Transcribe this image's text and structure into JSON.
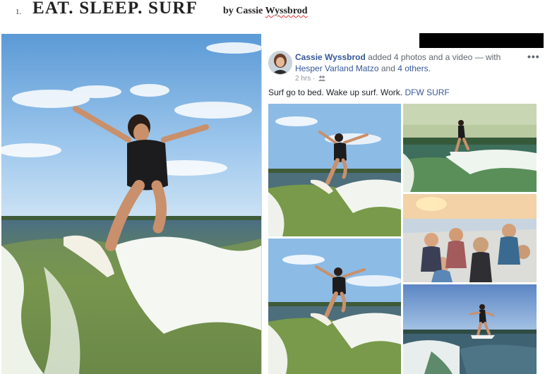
{
  "heading": {
    "number": "1.",
    "title": "EAT.  SLEEP.  SURF",
    "byline_prefix": "by Cassie",
    "byline_name": "Wyssbrod"
  },
  "post": {
    "author": "Cassie Wyssbrod",
    "action": "added 4 photos and a video",
    "with_text": "— with",
    "tagged_person": "Hesper Varland Matzo",
    "and_text": "and",
    "others": "4 others.",
    "time": "2 hrs",
    "audience_icon": "friends-icon",
    "more_icon": "more-options-icon",
    "body": "Surf go to bed. Wake up surf. Work.",
    "tag": "DFW SURF"
  },
  "media": [
    {
      "id": "photo-1",
      "kind": "photo",
      "subject": "surfer-wake-left"
    },
    {
      "id": "photo-2",
      "kind": "photo",
      "subject": "surfer-distant-wave"
    },
    {
      "id": "photo-3",
      "kind": "photo",
      "subject": "friends-on-boat"
    },
    {
      "id": "photo-4",
      "kind": "photo",
      "subject": "surfer-wake-left-2"
    },
    {
      "id": "video-1",
      "kind": "video",
      "subject": "surfer-sunset"
    }
  ],
  "colors": {
    "link": "#365899",
    "text": "#1d2129",
    "meta": "#90949c",
    "sky": "#7fb2e3",
    "water": "#5f7f4a"
  }
}
